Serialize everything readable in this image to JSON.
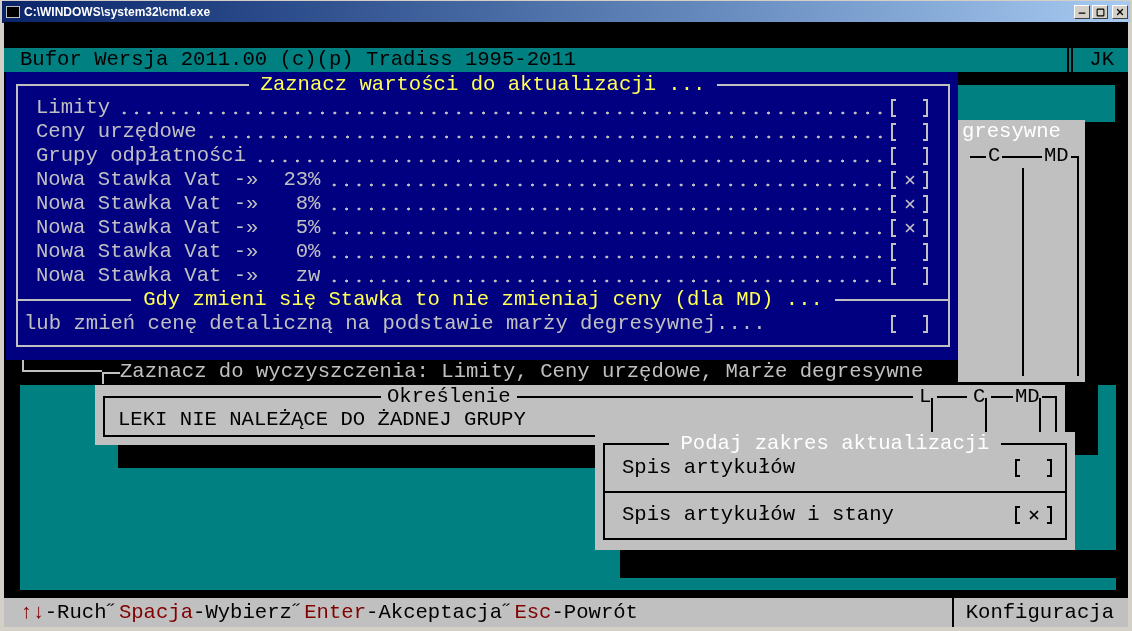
{
  "window": {
    "title": "C:\\WINDOWS\\system32\\cmd.exe"
  },
  "header": {
    "title": "Bufor Wersja 2011.00 (c)(p) Tradiss 1995-2011",
    "user": "JK"
  },
  "background_panel": {
    "title": "gresywne",
    "columns": [
      "C",
      "MD"
    ]
  },
  "clear_panel": {
    "title": "Zaznacz do wyczyszczenia: Limity, Ceny urzędowe, Marże degresywne"
  },
  "group_panel": {
    "title": "Określenie",
    "columns": [
      "L",
      "C",
      "MD"
    ],
    "row": "LEKI NIE NALEŻĄCE DO ŻADNEJ GRUPY"
  },
  "values_dialog": {
    "title": "Zaznacz wartości do aktualizacji ...",
    "items": [
      {
        "kind": "plain",
        "label": "Limity",
        "checked": false
      },
      {
        "kind": "plain",
        "label": "Ceny urzędowe",
        "checked": false
      },
      {
        "kind": "plain",
        "label": "Grupy odpłatności",
        "checked": false
      },
      {
        "kind": "vat",
        "label": "Nowa Stawka Vat -»",
        "rate": "23%",
        "checked": true
      },
      {
        "kind": "vat",
        "label": "Nowa Stawka Vat -»",
        "rate": "8%",
        "checked": true
      },
      {
        "kind": "vat",
        "label": "Nowa Stawka Vat -»",
        "rate": "5%",
        "checked": true
      },
      {
        "kind": "vat",
        "label": "Nowa Stawka Vat -»",
        "rate": "0%",
        "checked": false
      },
      {
        "kind": "vat",
        "label": "Nowa Stawka Vat -»",
        "rate": "zw",
        "checked": false
      }
    ],
    "section_title": "Gdy zmieni się Stawka to nie zmieniaj ceny (dla MD) ...",
    "option": {
      "label": "lub zmień cenę detaliczną na podstawie marży degresywnej....",
      "checked": false
    }
  },
  "scope_dialog": {
    "title": "Podaj zakres aktualizacji",
    "items": [
      {
        "label": "Spis artykułów",
        "checked": false
      },
      {
        "label": "Spis artykułów i stany",
        "checked": true
      }
    ]
  },
  "status_bar": {
    "keys": [
      {
        "key": "↑↓",
        "action": "-Ruch˝"
      },
      {
        "key": "Spacja",
        "action": "-Wybierz˝"
      },
      {
        "key": "Enter",
        "action": "-Akceptacja˝"
      },
      {
        "key": "Esc",
        "action": "-Powrót"
      }
    ],
    "right": "Konfiguracja"
  }
}
